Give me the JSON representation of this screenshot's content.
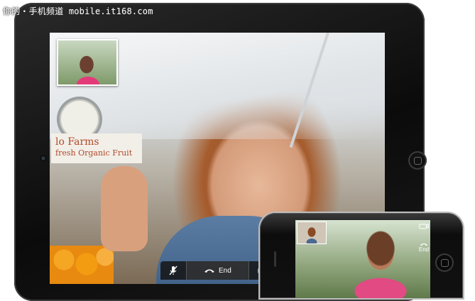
{
  "watermark": "你的・手机频道 mobile.it168.com",
  "ipad": {
    "call_controls": {
      "end_label": "End"
    },
    "market_sign": {
      "line1": "lo Farms",
      "line2": "fresh Organic Fruit"
    }
  },
  "iphone": {
    "end_label": "End"
  },
  "colors": {
    "call_bar_bg": "#141414",
    "device_black": "#0b0b0b",
    "pip_border": "#ffffff"
  },
  "icons": {
    "mute": "microphone-slash-icon",
    "end": "phone-hangup-icon",
    "swap": "camera-swap-icon"
  }
}
